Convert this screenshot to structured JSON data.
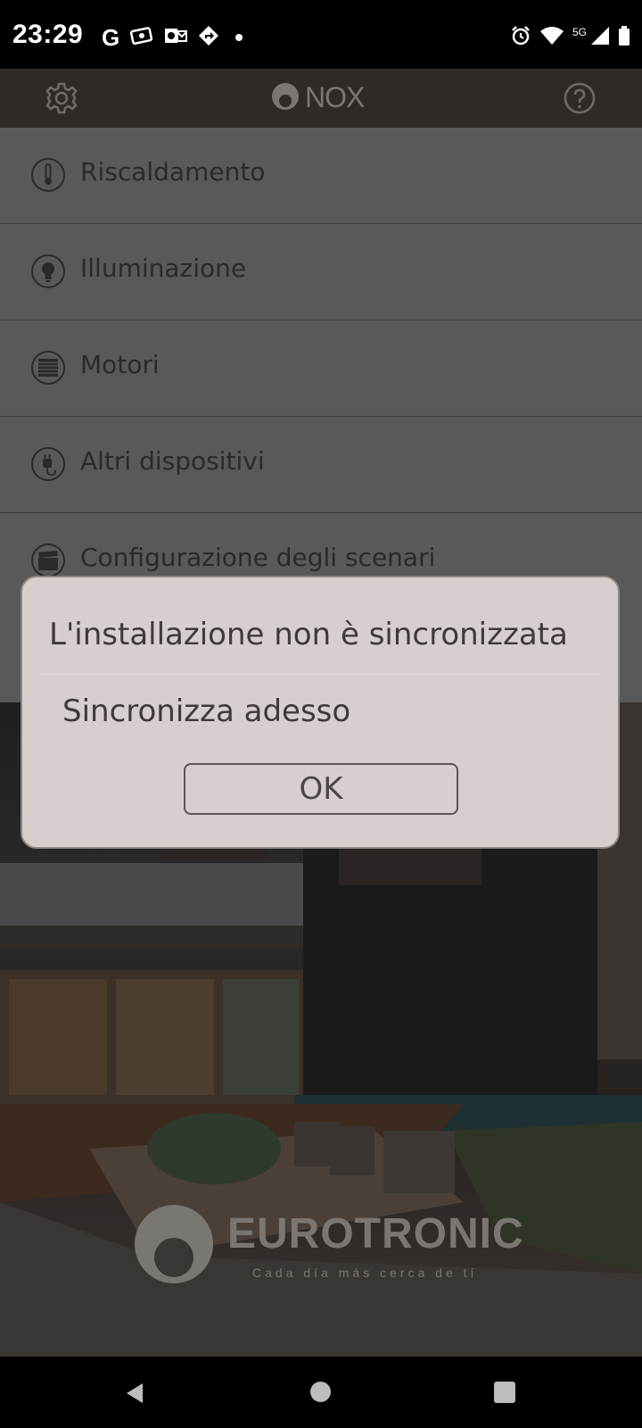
{
  "status_bar": {
    "time": "23:29",
    "left_icons": [
      "google-g-icon",
      "ticket-icon",
      "outlook-icon",
      "maps-direction-icon",
      "notification-dot-icon"
    ],
    "network_label": "5G",
    "right_icons": [
      "alarm-icon",
      "wifi-icon",
      "cell-signal-icon",
      "battery-icon"
    ]
  },
  "app_bar": {
    "brand": "NOX",
    "left_icon": "gear-icon",
    "right_icon": "help-icon"
  },
  "menu": {
    "items": [
      {
        "label": "Riscaldamento",
        "icon": "thermometer-icon"
      },
      {
        "label": "Illuminazione",
        "icon": "lightbulb-icon"
      },
      {
        "label": "Motori",
        "icon": "shutter-icon"
      },
      {
        "label": "Altri dispositivi",
        "icon": "plug-icon"
      },
      {
        "label": "Configurazione degli scenari",
        "icon": "clapperboard-icon"
      }
    ]
  },
  "dialog": {
    "title": "L'installazione non è sincronizzata",
    "message": "Sincronizza adesso",
    "ok_label": "OK"
  },
  "background": {
    "logo_text": "EUROTRONIC",
    "logo_tagline": "Cada día más cerca de tí"
  },
  "nav_bar": {
    "icons": [
      "back-icon",
      "home-icon",
      "recents-icon"
    ]
  },
  "colors": {
    "app_bar": "#2f2a26",
    "menu_overlay": "#595959",
    "dialog_bg": "#d6cfcd",
    "text_dark": "#3d3a39"
  }
}
